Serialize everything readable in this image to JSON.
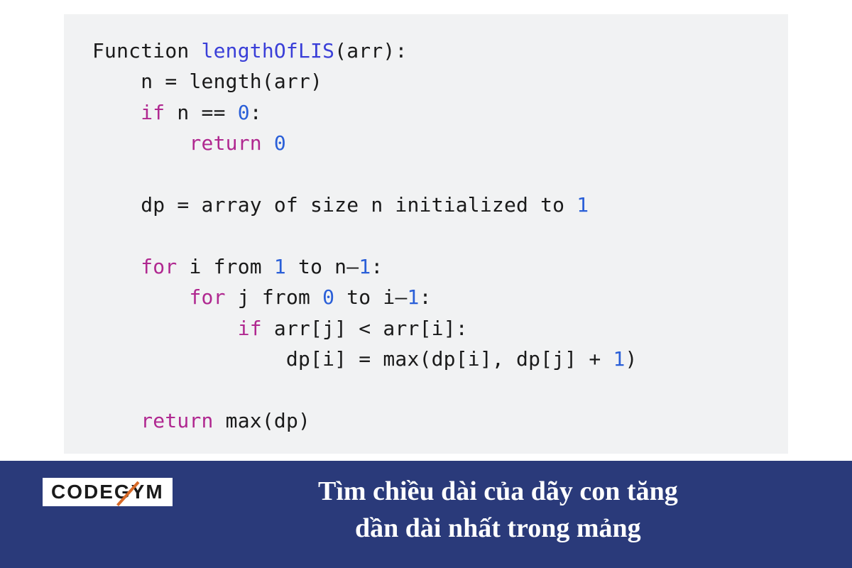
{
  "code": {
    "l1_a": "Function ",
    "l1_fn": "lengthOfLIS",
    "l1_b": "(arr):",
    "l2": "    n = length(arr)",
    "l3_a": "    ",
    "l3_kw": "if",
    "l3_b": " n == ",
    "l3_lit": "0",
    "l3_c": ":",
    "l4_a": "        ",
    "l4_kw": "return",
    "l4_b": " ",
    "l4_lit": "0",
    "l5": "",
    "l6_a": "    dp = array of size n initialized to ",
    "l6_lit": "1",
    "l7": "",
    "l8_a": "    ",
    "l8_kw": "for",
    "l8_b": " i from ",
    "l8_lit1": "1",
    "l8_c": " to n–",
    "l8_lit2": "1",
    "l8_d": ":",
    "l9_a": "        ",
    "l9_kw": "for",
    "l9_b": " j from ",
    "l9_lit1": "0",
    "l9_c": " to i–",
    "l9_lit2": "1",
    "l9_d": ":",
    "l10_a": "            ",
    "l10_kw": "if",
    "l10_b": " arr[j] < arr[i]:",
    "l11_a": "                dp[i] = max(dp[i], dp[j] + ",
    "l11_lit": "1",
    "l11_b": ")",
    "l12": "",
    "l13_a": "    ",
    "l13_kw": "return",
    "l13_b": " max(dp)"
  },
  "footer": {
    "logo": "CODEGYM",
    "caption_line1": "Tìm chiều dài của dãy con tăng",
    "caption_line2": "dần dài nhất trong mảng"
  }
}
